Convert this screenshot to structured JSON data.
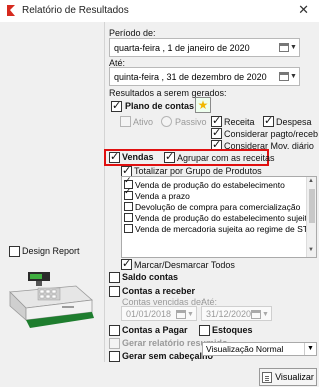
{
  "window": {
    "title": "Relatório de Resultados",
    "close_glyph": "✕"
  },
  "periodo": {
    "de_label": "Período de:",
    "de_value": "quarta-feira , 1 de janeiro de 2020",
    "ate_label": "Até:",
    "ate_value": "quinta-feira , 31 de dezembro de 2020"
  },
  "resultados_label": "Resultados a serem gerados:",
  "plano": {
    "label": "Plano de contas",
    "ativo": "Ativo",
    "passivo": "Passivo",
    "receita": "Receita",
    "despesa": "Despesa",
    "considerar_pago": "Considerar pagto/receb",
    "considerar_mov": "Considerar Mov. diário"
  },
  "vendas": {
    "label": "Vendas",
    "agrupar": "Agrupar com as receitas",
    "totalizar": "Totalizar por Grupo de Produtos",
    "items": [
      {
        "label": "Venda de produção do estabelecimento",
        "checked": true
      },
      {
        "label": "Venda a prazo",
        "checked": true
      },
      {
        "label": "Devolução de compra para comercialização",
        "checked": false
      },
      {
        "label": "Venda de produção do estabelecimento sujeita",
        "checked": false
      },
      {
        "label": "Venda de mercadoria sujeita ao regime de ST",
        "checked": false
      }
    ],
    "marcar": "Marcar/Desmarcar Todos"
  },
  "saldo_contas": "Saldo contas",
  "contas_receber": {
    "label": "Contas a receber",
    "vencidas_label": "Contas vencidas de:",
    "ate_label": "Até:",
    "de_value": "01/01/2018",
    "ate_value": "31/12/2020"
  },
  "contas_pagar": "Contas a Pagar",
  "estoques": "Estoques",
  "gerar_resumido": "Gerar relatório resumido",
  "gerar_sem_cabecalho": "Gerar sem cabeçalho",
  "design_report": "Design Report",
  "visualizacao": {
    "selected": "Visualização Normal"
  },
  "visualizar_button": "Visualizar",
  "colors": {
    "highlight_border": "#e01010",
    "star": "#f2b800"
  }
}
